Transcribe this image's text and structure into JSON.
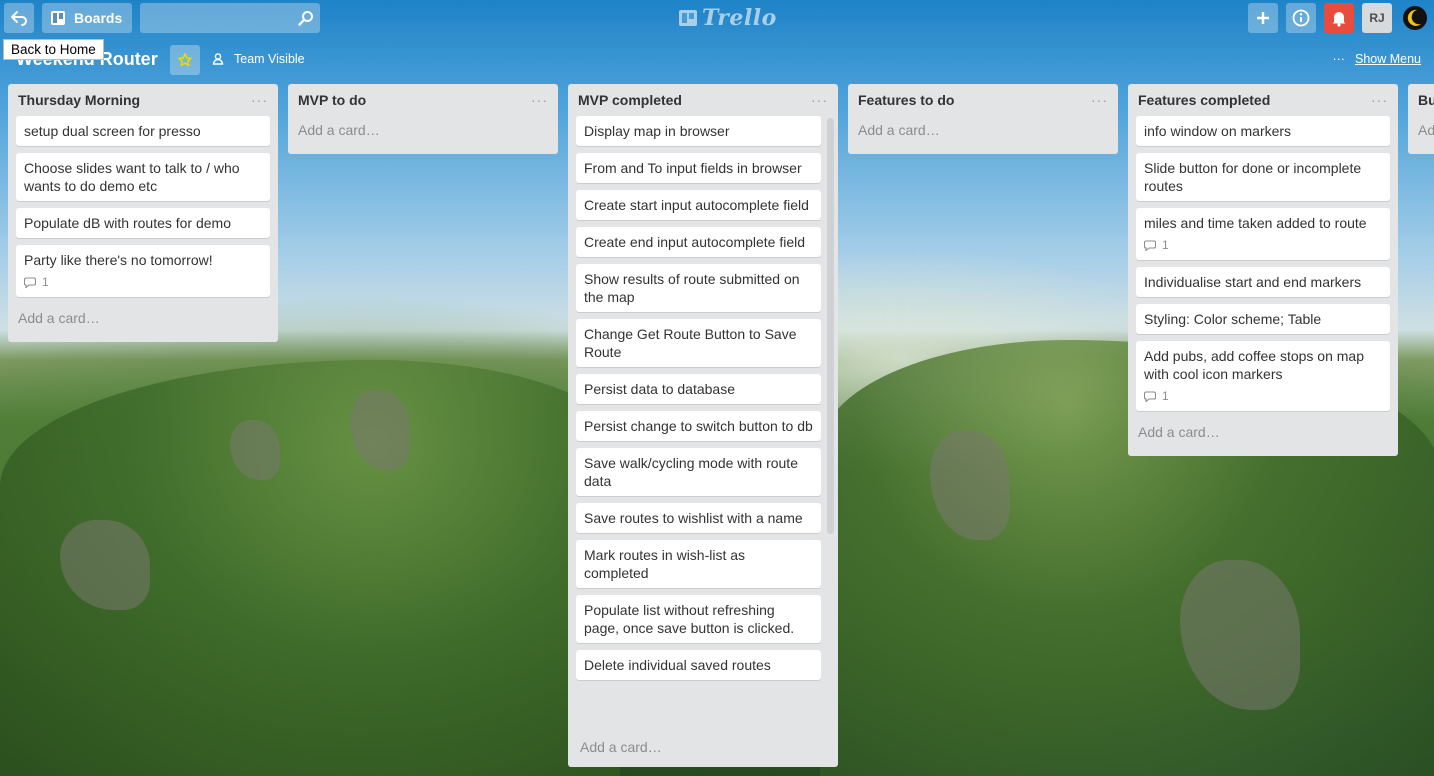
{
  "header": {
    "boards_label": "Boards",
    "search_placeholder": "",
    "logo_text": "Trello",
    "avatar_initials": "RJ"
  },
  "tooltip": "Back to Home",
  "board": {
    "title": "Weekend Router",
    "visibility": "Team Visible",
    "show_menu": "Show Menu"
  },
  "lists": [
    {
      "title": "Thursday Morning",
      "cards": [
        {
          "text": "setup dual screen for presso"
        },
        {
          "text": "Choose slides want to talk to / who wants to do demo etc"
        },
        {
          "text": "Populate dB with routes for demo"
        },
        {
          "text": "Party like there's no tomorrow!",
          "comments": "1"
        }
      ],
      "add": "Add a card…"
    },
    {
      "title": "MVP to do",
      "cards": [],
      "add": "Add a card…"
    },
    {
      "title": "MVP completed",
      "cards": [
        {
          "text": "Display map in browser"
        },
        {
          "text": "From and To input fields in browser"
        },
        {
          "text": "Create start input autocomplete field"
        },
        {
          "text": "Create end input autocomplete field"
        },
        {
          "text": "Show results of route submitted on the map"
        },
        {
          "text": "Change Get Route Button to Save Route"
        },
        {
          "text": "Persist data to database"
        },
        {
          "text": "Persist change to switch button to db"
        },
        {
          "text": "Save walk/cycling mode with route data"
        },
        {
          "text": "Save routes to wishlist with a name"
        },
        {
          "text": "Mark routes in wish-list as completed"
        },
        {
          "text": "Populate list without refreshing page, once save button is clicked."
        },
        {
          "text": "Delete individual saved routes"
        }
      ],
      "add": "Add a card…"
    },
    {
      "title": "Features to do",
      "cards": [],
      "add": "Add a card…"
    },
    {
      "title": "Features completed",
      "cards": [
        {
          "text": "info window on markers"
        },
        {
          "text": "Slide button for done or incomplete routes"
        },
        {
          "text": "miles and time taken added to route",
          "comments": "1"
        },
        {
          "text": "Individualise start and end markers"
        },
        {
          "text": "Styling: Color scheme; Table"
        },
        {
          "text": "Add pubs, add coffee stops on map with cool icon markers",
          "comments": "1"
        }
      ],
      "add": "Add a card…"
    },
    {
      "title": "Bu",
      "cards": [],
      "add": "Ad"
    }
  ]
}
